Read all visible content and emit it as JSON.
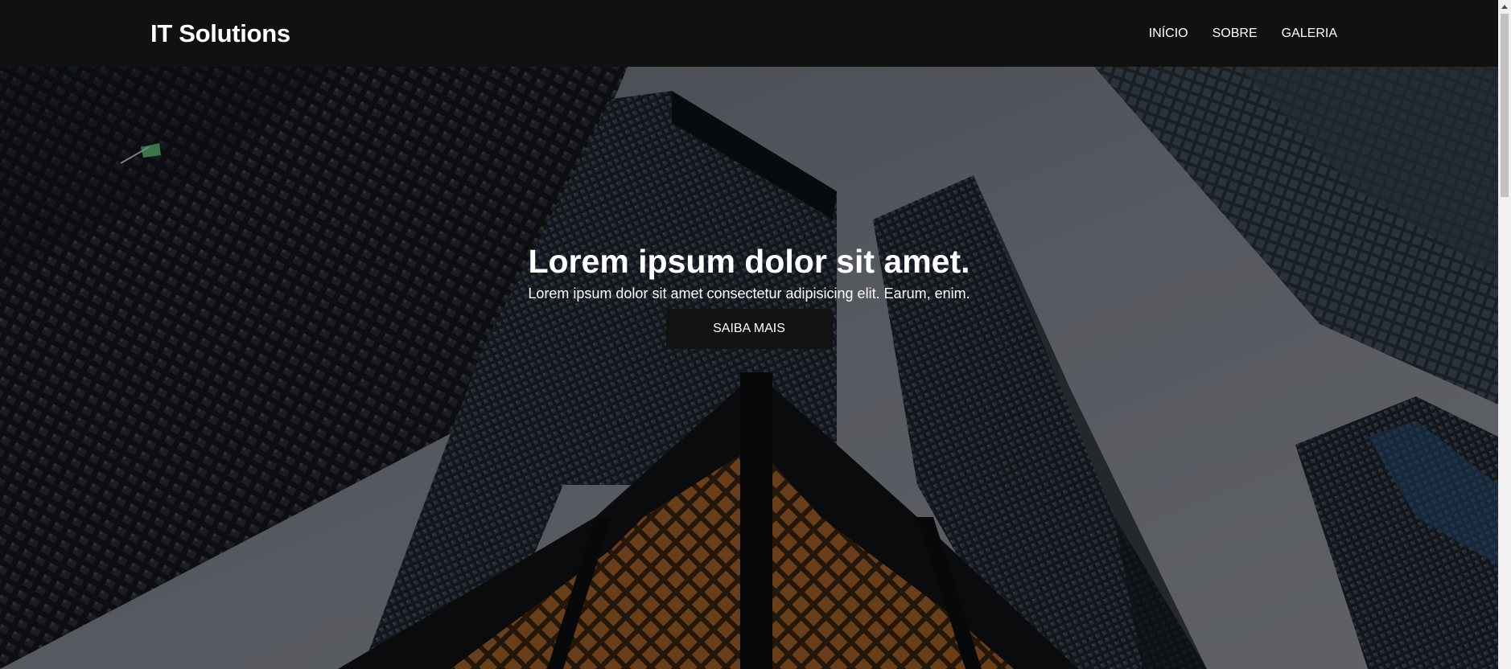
{
  "header": {
    "brand": "IT Solutions",
    "nav": [
      {
        "label": "INÍCIO"
      },
      {
        "label": "SOBRE"
      },
      {
        "label": "GALERIA"
      }
    ]
  },
  "hero": {
    "title": "Lorem ipsum dolor sit amet.",
    "subtitle": "Lorem ipsum dolor sit amet consectetur adipisicing elit. Earum, enim.",
    "cta_label": "SAIBA MAIS",
    "background": "skyscrapers-photo"
  },
  "colors": {
    "navbar": "#111113",
    "button": "#121212",
    "text": "#ffffff"
  }
}
